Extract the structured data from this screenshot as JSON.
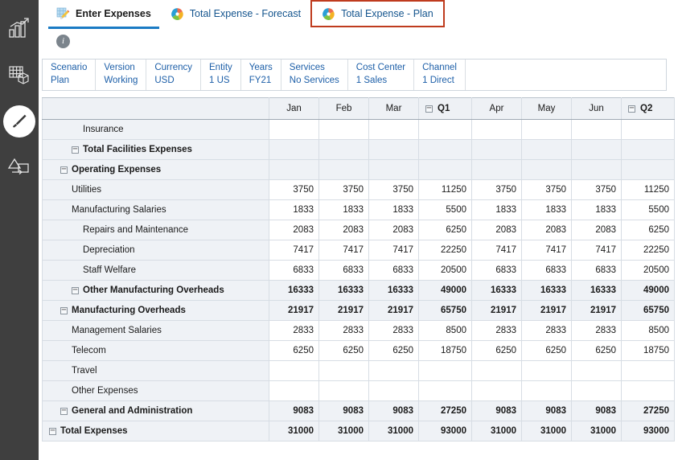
{
  "rail": {
    "items": [
      {
        "name": "dashboard-icon",
        "label": "Dashboard",
        "active": false
      },
      {
        "name": "data-cube-icon",
        "label": "Data",
        "active": false
      },
      {
        "name": "brush-icon",
        "label": "Designer",
        "active": true
      },
      {
        "name": "shapes-icon",
        "label": "Navigation Flow",
        "active": false
      }
    ]
  },
  "tabs": [
    {
      "label": "Enter Expenses",
      "icon": "grid-pencil-icon",
      "active": true,
      "annotated": false
    },
    {
      "label": "Total Expense - Forecast",
      "icon": "pie-chart-icon",
      "active": false,
      "annotated": false
    },
    {
      "label": "Total Expense - Plan",
      "icon": "pie-chart-icon",
      "active": false,
      "annotated": true
    }
  ],
  "info": {
    "glyph": "i",
    "tooltip": "Information"
  },
  "pov": [
    {
      "dimension": "Scenario",
      "member": "Plan"
    },
    {
      "dimension": "Version",
      "member": "Working"
    },
    {
      "dimension": "Currency",
      "member": "USD"
    },
    {
      "dimension": "Entity",
      "member": "1 US"
    },
    {
      "dimension": "Years",
      "member": "FY21"
    },
    {
      "dimension": "Services",
      "member": "No Services"
    },
    {
      "dimension": "Cost Center",
      "member": "1 Sales"
    },
    {
      "dimension": "Channel",
      "member": "1 Direct"
    }
  ],
  "grid": {
    "columns": [
      {
        "label": "Jan",
        "collapsible": false,
        "bold": false
      },
      {
        "label": "Feb",
        "collapsible": false,
        "bold": false
      },
      {
        "label": "Mar",
        "collapsible": false,
        "bold": false
      },
      {
        "label": "Q1",
        "collapsible": true,
        "bold": true
      },
      {
        "label": "Apr",
        "collapsible": false,
        "bold": false
      },
      {
        "label": "May",
        "collapsible": false,
        "bold": false
      },
      {
        "label": "Jun",
        "collapsible": false,
        "bold": false
      },
      {
        "label": "Q2",
        "collapsible": true,
        "bold": true
      }
    ],
    "collapse_glyph": "─",
    "rows": [
      {
        "label": "Insurance",
        "indent": 3,
        "collapsible": false,
        "bold": false,
        "calc": false,
        "values": [
          "",
          "",
          "",
          "",
          "",
          "",
          "",
          ""
        ]
      },
      {
        "label": "Total Facilities Expenses",
        "indent": 2,
        "collapsible": true,
        "bold": true,
        "calc": false,
        "shaded": true,
        "values": [
          "",
          "",
          "",
          "",
          "",
          "",
          "",
          ""
        ]
      },
      {
        "label": "Operating Expenses",
        "indent": 1,
        "collapsible": true,
        "bold": true,
        "calc": false,
        "shaded": true,
        "values": [
          "",
          "",
          "",
          "",
          "",
          "",
          "",
          ""
        ]
      },
      {
        "label": "Utilities",
        "indent": 2,
        "collapsible": false,
        "bold": false,
        "calc": false,
        "values": [
          "3750",
          "3750",
          "3750",
          "11250",
          "3750",
          "3750",
          "3750",
          "11250"
        ]
      },
      {
        "label": "Manufacturing Salaries",
        "indent": 2,
        "collapsible": false,
        "bold": false,
        "calc": false,
        "values": [
          "1833",
          "1833",
          "1833",
          "5500",
          "1833",
          "1833",
          "1833",
          "5500"
        ]
      },
      {
        "label": "Repairs and Maintenance",
        "indent": 3,
        "collapsible": false,
        "bold": false,
        "calc": false,
        "values": [
          "2083",
          "2083",
          "2083",
          "6250",
          "2083",
          "2083",
          "2083",
          "6250"
        ]
      },
      {
        "label": "Depreciation",
        "indent": 3,
        "collapsible": false,
        "bold": false,
        "calc": false,
        "values": [
          "7417",
          "7417",
          "7417",
          "22250",
          "7417",
          "7417",
          "7417",
          "22250"
        ]
      },
      {
        "label": "Staff Welfare",
        "indent": 3,
        "collapsible": false,
        "bold": false,
        "calc": false,
        "values": [
          "6833",
          "6833",
          "6833",
          "20500",
          "6833",
          "6833",
          "6833",
          "20500"
        ]
      },
      {
        "label": "Other Manufacturing Overheads",
        "indent": 2,
        "collapsible": true,
        "bold": true,
        "calc": true,
        "values": [
          "16333",
          "16333",
          "16333",
          "49000",
          "16333",
          "16333",
          "16333",
          "49000"
        ]
      },
      {
        "label": "Manufacturing Overheads",
        "indent": 1,
        "collapsible": true,
        "bold": true,
        "calc": true,
        "values": [
          "21917",
          "21917",
          "21917",
          "65750",
          "21917",
          "21917",
          "21917",
          "65750"
        ]
      },
      {
        "label": "Management Salaries",
        "indent": 2,
        "collapsible": false,
        "bold": false,
        "calc": false,
        "values": [
          "2833",
          "2833",
          "2833",
          "8500",
          "2833",
          "2833",
          "2833",
          "8500"
        ]
      },
      {
        "label": "Telecom",
        "indent": 2,
        "collapsible": false,
        "bold": false,
        "calc": false,
        "values": [
          "6250",
          "6250",
          "6250",
          "18750",
          "6250",
          "6250",
          "6250",
          "18750"
        ]
      },
      {
        "label": "Travel",
        "indent": 2,
        "collapsible": false,
        "bold": false,
        "calc": false,
        "values": [
          "",
          "",
          "",
          "",
          "",
          "",
          "",
          ""
        ]
      },
      {
        "label": "Other Expenses",
        "indent": 2,
        "collapsible": false,
        "bold": false,
        "calc": false,
        "values": [
          "",
          "",
          "",
          "",
          "",
          "",
          "",
          ""
        ]
      },
      {
        "label": "General and Administration",
        "indent": 1,
        "collapsible": true,
        "bold": true,
        "calc": true,
        "values": [
          "9083",
          "9083",
          "9083",
          "27250",
          "9083",
          "9083",
          "9083",
          "27250"
        ]
      },
      {
        "label": "Total Expenses",
        "indent": 0,
        "collapsible": true,
        "bold": true,
        "calc": true,
        "values": [
          "31000",
          "31000",
          "31000",
          "93000",
          "31000",
          "31000",
          "31000",
          "93000"
        ]
      }
    ]
  },
  "colors": {
    "rail_bg": "#3f3f3f",
    "tab_active_underline": "#1a7bc4",
    "annotation_border": "#bf3b1e",
    "link_blue": "#1d5fa8",
    "calc_row_bg": "#eff2f6"
  }
}
